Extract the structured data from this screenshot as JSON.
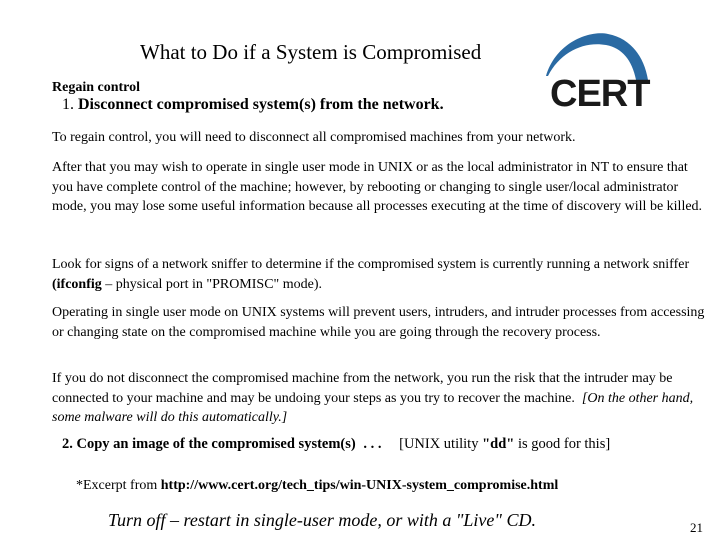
{
  "slide": {
    "title": "What to Do if a System is Compromised",
    "logo": {
      "text": "CERT",
      "arc_color": "#2a6aa3",
      "text_color": "#1a1a1a"
    },
    "section_heading": "Regain control",
    "step1": {
      "number": "1.",
      "text": "Disconnect compromised system(s) from the network."
    },
    "paragraphs": {
      "p1": "To regain control, you will need to disconnect all compromised machines from your network.",
      "p2": "After that you may wish to operate in single user mode in UNIX or as the local administrator in NT to ensure that you have complete control of the machine; however, by rebooting or changing to single user/local administrator mode, you may lose some useful information because all processes executing at the time of discovery will be killed.",
      "p3_before": "Look for signs of a network sniffer to determine if the compromised system is currently running a network sniffer ",
      "p3_bold": "(ifconfig",
      "p3_after": " – physical port in \"PROMISC\" mode).",
      "p4": "Operating in single user mode on UNIX systems will prevent users, intruders, and intruder processes from accessing or changing state on the compromised machine while you are going through the recovery process.",
      "p5_main": "If you do not disconnect the compromised machine from the network, you run the risk that the intruder may be connected to your machine and may be undoing your steps as you try to recover the machine.",
      "p5_italic": "[On the other hand, some malware will do this automatically.]"
    },
    "step2": {
      "label": "2. Copy an image of the compromised system(s)",
      "ellipsis": ". . .",
      "note_before": "[UNIX utility ",
      "note_bold": "\"dd\"",
      "note_after": " is good for this]"
    },
    "excerpt": {
      "prefix": "*Excerpt from ",
      "url": "http://www.cert.org/tech_tips/win-UNIX-system_compromise.html"
    },
    "footer_note": "Turn off – restart in single-user mode, or with a \"Live\" CD.",
    "page_number": "21"
  }
}
